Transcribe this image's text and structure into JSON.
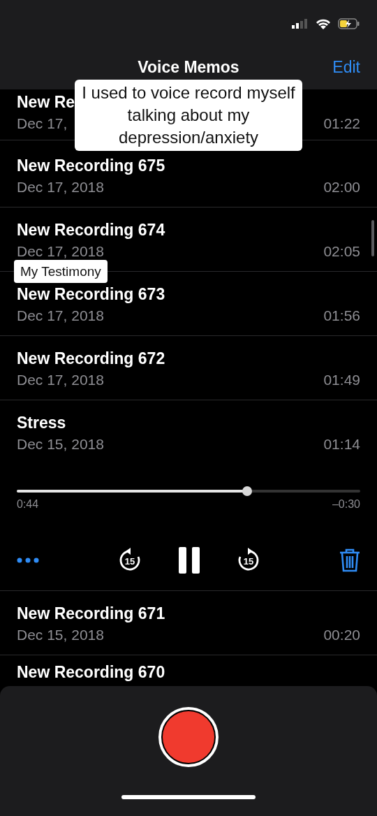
{
  "header": {
    "title": "Voice Memos",
    "action": "Edit"
  },
  "recordings": [
    {
      "title": "New Re",
      "date": "Dec 17,",
      "duration": "01:22",
      "expanded": false
    },
    {
      "title": "New Recording 675",
      "date": "Dec 17, 2018",
      "duration": "02:00",
      "expanded": false
    },
    {
      "title": "New Recording 674",
      "date": "Dec 17, 2018",
      "duration": "02:05",
      "expanded": false
    },
    {
      "title": "New Recording 673",
      "date": "Dec 17, 2018",
      "duration": "01:56",
      "expanded": false
    },
    {
      "title": "New Recording 672",
      "date": "Dec 17, 2018",
      "duration": "01:49",
      "expanded": false
    },
    {
      "title": "Stress",
      "date": "Dec 15, 2018",
      "duration": "01:14",
      "expanded": true,
      "player": {
        "level": 0.67,
        "elapsed": "0:44",
        "remaining": "–0:30",
        "playing": true,
        "skip_back": "15",
        "skip_forward": "15"
      }
    },
    {
      "title": "New Recording 671",
      "date": "Dec 15, 2018",
      "duration": "00:20",
      "expanded": false
    },
    {
      "title": "New Recording 670",
      "expanded": false
    }
  ],
  "captions": [
    {
      "text": "I used to voice record myself talking about my depression/anxiety",
      "kind": "large"
    },
    {
      "text": "My Testimony",
      "kind": "small"
    }
  ],
  "recorder": {
    "recording": false
  }
}
